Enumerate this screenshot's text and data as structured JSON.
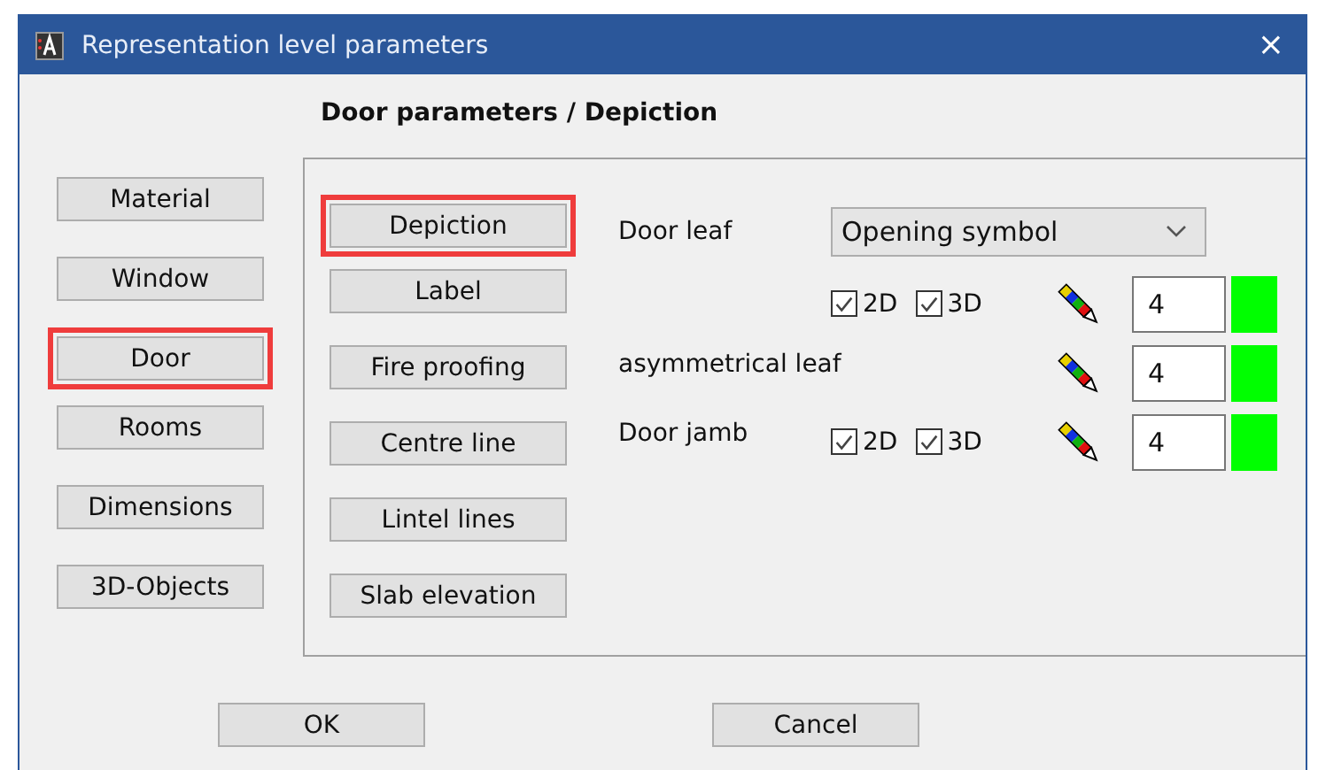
{
  "window": {
    "title": "Representation level parameters",
    "close": "×"
  },
  "heading": "Door parameters / Depiction",
  "categories": [
    {
      "label": "Material",
      "selected": false
    },
    {
      "label": "Window",
      "selected": false
    },
    {
      "label": "Door",
      "selected": true
    },
    {
      "label": "Rooms",
      "selected": false
    },
    {
      "label": "Dimensions",
      "selected": false
    },
    {
      "label": "3D-Objects",
      "selected": false
    }
  ],
  "sections": [
    {
      "label": "Depiction",
      "selected": true
    },
    {
      "label": "Label",
      "selected": false
    },
    {
      "label": "Fire proofing",
      "selected": false
    },
    {
      "label": "Centre line",
      "selected": false
    },
    {
      "label": "Lintel lines",
      "selected": false
    },
    {
      "label": "Slab elevation",
      "selected": false
    }
  ],
  "rows": [
    {
      "kind": "dropdown",
      "label": "Door leaf",
      "value": "Opening symbol"
    },
    {
      "kind": "pen",
      "checks": [
        {
          "label": "2D",
          "checked": true
        },
        {
          "label": "3D",
          "checked": true
        }
      ],
      "pen": "4",
      "color": "#00ff00"
    },
    {
      "kind": "pen",
      "label": "asymmetrical leaf",
      "pen": "4",
      "color": "#00ff00"
    },
    {
      "kind": "pen",
      "label": "Door jamb",
      "checks": [
        {
          "label": "2D",
          "checked": true
        },
        {
          "label": "3D",
          "checked": true
        }
      ],
      "pen": "4",
      "color": "#00ff00"
    }
  ],
  "buttons": [
    "OK",
    "Cancel"
  ]
}
